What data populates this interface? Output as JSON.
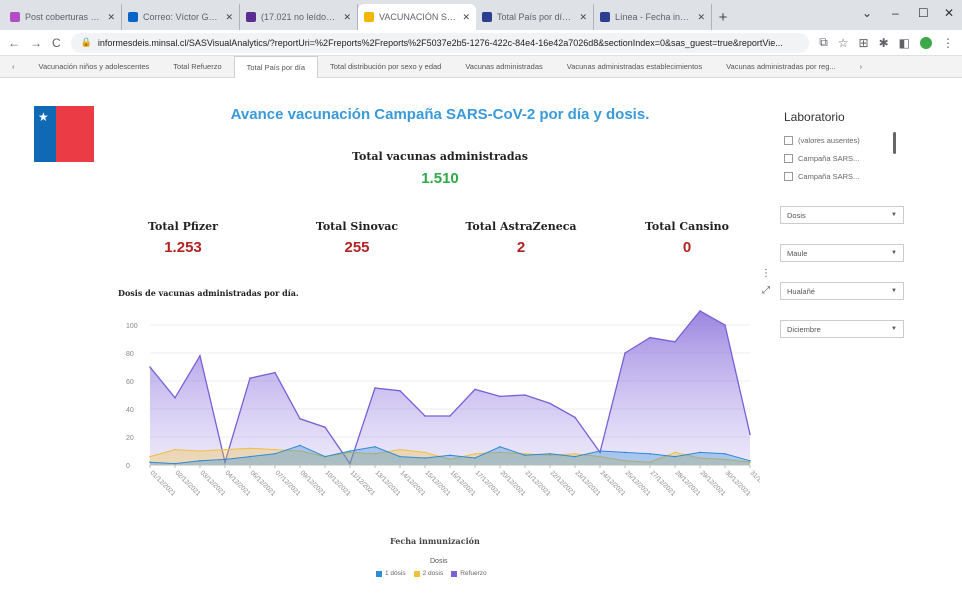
{
  "browser": {
    "tabs": [
      {
        "title": "Post coberturas SARS-",
        "color": "#b14cc6",
        "active": false
      },
      {
        "title": "Correo: Víctor Gutiérrez",
        "color": "#0a64c8",
        "active": false
      },
      {
        "title": "(17.021 no leídos) - vict",
        "color": "#5c2d91",
        "active": false
      },
      {
        "title": "VACUNACIÓN SARS-Co",
        "color": "#f2b600",
        "active": true
      },
      {
        "title": "Total País por día del 1",
        "color": "#2c3e8f",
        "active": false
      },
      {
        "title": "Línea - Fecha inmuniza",
        "color": "#2c3e8f",
        "active": false
      }
    ],
    "url": "informesdeis.minsal.cl/SASVisualAnalytics/?reportUri=%2Freports%2Freports%2F5037e2b5-1276-422c-84e4-16e42a7026d8&sectionIndex=0&sas_guest=true&reportVie..."
  },
  "report_tabs": [
    "Vacunación niños y adolescentes",
    "Total Refuerzo",
    "Total País por día",
    "Total distribución por sexo y edad",
    "Vacunas administradas",
    "Vacunas administradas establecimientos",
    "Vacunas administradas por reg..."
  ],
  "active_report_tab": 2,
  "header": {
    "title": "Avance vacunación Campaña SARS-CoV-2 por día y dosis.",
    "total_label": "Total vacunas administradas",
    "total_value": "1.510"
  },
  "kpis": [
    {
      "label": "Total Pfizer",
      "value": "1.253"
    },
    {
      "label": "Total Sinovac",
      "value": "255"
    },
    {
      "label": "Total AstraZeneca",
      "value": "2"
    },
    {
      "label": "Total Cansino",
      "value": "0"
    }
  ],
  "sidebar": {
    "title": "Laboratorio",
    "checkboxes": [
      "(valores ausentes)",
      "Campaña SARS...",
      "Campaña SARS..."
    ],
    "dropdowns": [
      "Dosis",
      "Maule",
      "Hualañé",
      "Diciembre"
    ]
  },
  "colors": {
    "dosis1": "#2e8bd6",
    "dosis2": "#f0c040",
    "refuerzo": "#7b5fd6"
  },
  "chart_data": {
    "type": "area",
    "title": "Dosis de vacunas administradas por día.",
    "xlabel": "Fecha inmunización",
    "legend_title": "Dosis",
    "x": [
      "01/12/2021",
      "02/12/2021",
      "03/12/2021",
      "04/12/2021",
      "06/12/2021",
      "07/12/2021",
      "09/12/2021",
      "10/12/2021",
      "11/12/2021",
      "13/12/2021",
      "14/12/2021",
      "15/12/2021",
      "16/12/2021",
      "17/12/2021",
      "20/12/2021",
      "21/12/2021",
      "22/12/2021",
      "23/12/2021",
      "24/12/2021",
      "25/12/2021",
      "27/12/2021",
      "28/12/2021",
      "29/12/2021",
      "30/12/2021",
      "31/12/2021"
    ],
    "ylim": [
      0,
      110
    ],
    "yticks": [
      0,
      20,
      40,
      60,
      80,
      100
    ],
    "series": [
      {
        "name": "1 dosis",
        "color": "#2e8bd6",
        "values": [
          2,
          1,
          3,
          4,
          6,
          8,
          14,
          6,
          10,
          13,
          6,
          5,
          7,
          5,
          13,
          7,
          8,
          6,
          10,
          9,
          8,
          6,
          9,
          8,
          3
        ]
      },
      {
        "name": "2 dosis",
        "color": "#f0c040",
        "values": [
          6,
          11,
          10,
          11,
          12,
          11,
          10,
          6,
          9,
          8,
          11,
          9,
          4,
          8,
          9,
          8,
          7,
          8,
          6,
          3,
          2,
          9,
          5,
          4,
          2
        ]
      },
      {
        "name": "Refuerzo",
        "color": "#7b5fd6",
        "values": [
          70,
          48,
          78,
          2,
          62,
          66,
          33,
          27,
          1,
          55,
          53,
          35,
          35,
          54,
          49,
          50,
          44,
          34,
          9,
          80,
          91,
          88,
          110,
          100,
          22
        ]
      }
    ]
  }
}
